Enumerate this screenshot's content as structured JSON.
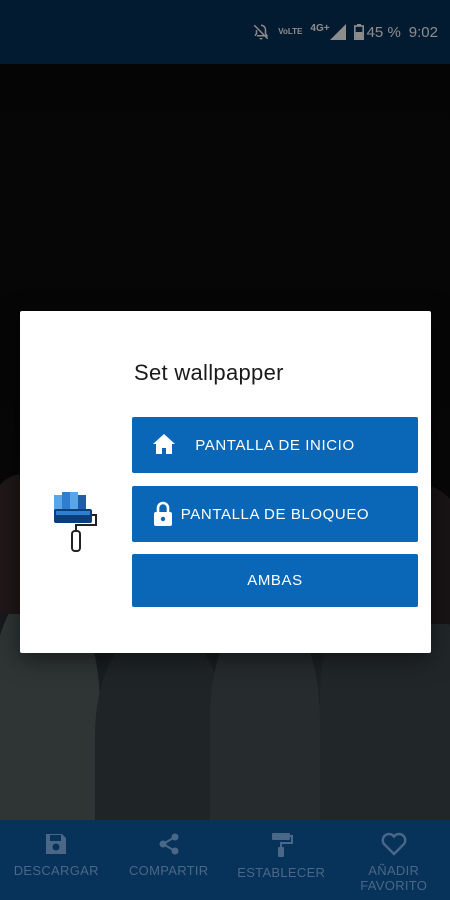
{
  "status_bar": {
    "network_label": "VoLTE",
    "network_type": "4G+",
    "battery_percent": "45 %",
    "time": "9:02"
  },
  "dialog": {
    "title": "Set wallpapper",
    "buttons": {
      "home_screen": "PANTALLA DE INICIO",
      "lock_screen": "PANTALLA DE BLOQUEO",
      "both": "AMBAS"
    }
  },
  "bottom_nav": {
    "download": "DESCARGAR",
    "share": "COMPARTIR",
    "set": "ESTABLECER",
    "favorite": "AÑADIR FAVORITO"
  },
  "colors": {
    "top_bar": "#07325a",
    "button": "#0a66b7",
    "nav_inactive": "#4b6787"
  }
}
